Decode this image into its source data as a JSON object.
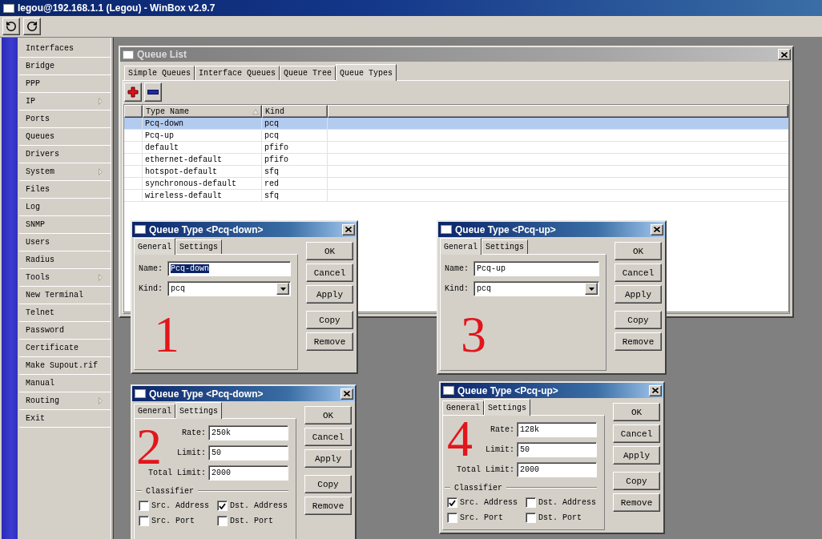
{
  "window": {
    "title": "legou@192.168.1.1 (Legou) - WinBox v2.9.7"
  },
  "sidebar": {
    "items": [
      {
        "label": "Interfaces",
        "has_submenu": false
      },
      {
        "label": "Bridge",
        "has_submenu": false
      },
      {
        "label": "PPP",
        "has_submenu": false
      },
      {
        "label": "IP",
        "has_submenu": true
      },
      {
        "label": "Ports",
        "has_submenu": false
      },
      {
        "label": "Queues",
        "has_submenu": false
      },
      {
        "label": "Drivers",
        "has_submenu": false
      },
      {
        "label": "System",
        "has_submenu": true
      },
      {
        "label": "Files",
        "has_submenu": false
      },
      {
        "label": "Log",
        "has_submenu": false
      },
      {
        "label": "SNMP",
        "has_submenu": false
      },
      {
        "label": "Users",
        "has_submenu": false
      },
      {
        "label": "Radius",
        "has_submenu": false
      },
      {
        "label": "Tools",
        "has_submenu": true
      },
      {
        "label": "New Terminal",
        "has_submenu": false
      },
      {
        "label": "Telnet",
        "has_submenu": false
      },
      {
        "label": "Password",
        "has_submenu": false
      },
      {
        "label": "Certificate",
        "has_submenu": false
      },
      {
        "label": "Make Supout.rif",
        "has_submenu": false
      },
      {
        "label": "Manual",
        "has_submenu": false
      },
      {
        "label": "Routing",
        "has_submenu": true
      },
      {
        "label": "Exit",
        "has_submenu": false
      }
    ]
  },
  "queue_list": {
    "title": "Queue List",
    "active": false,
    "tabs": [
      {
        "label": "Simple Queues",
        "selected": false
      },
      {
        "label": "Interface Queues",
        "selected": false
      },
      {
        "label": "Queue Tree",
        "selected": false
      },
      {
        "label": "Queue Types",
        "selected": true
      }
    ],
    "table": {
      "columns": [
        {
          "label": "Type Name",
          "sorted": true
        },
        {
          "label": "Kind",
          "sorted": false
        }
      ],
      "rows": [
        {
          "cells": [
            "Pcq-down",
            "pcq"
          ],
          "selected": true
        },
        {
          "cells": [
            "Pcq-up",
            "pcq"
          ],
          "selected": false
        },
        {
          "cells": [
            "default",
            "pfifo"
          ],
          "selected": false
        },
        {
          "cells": [
            "ethernet-default",
            "pfifo"
          ],
          "selected": false
        },
        {
          "cells": [
            "hotspot-default",
            "sfq"
          ],
          "selected": false
        },
        {
          "cells": [
            "synchronous-default",
            "red"
          ],
          "selected": false
        },
        {
          "cells": [
            "wireless-default",
            "sfq"
          ],
          "selected": false
        }
      ]
    }
  },
  "dialogs": [
    {
      "kind": "general",
      "title": "Queue Type <Pcq-down>",
      "active": true,
      "annotation": "1",
      "tabs": [
        {
          "label": "General",
          "selected": true
        },
        {
          "label": "Settings",
          "selected": false
        }
      ],
      "fields": [
        {
          "kind": "text",
          "label": "Name:",
          "value": "Pcq-down",
          "text_selected": true
        },
        {
          "kind": "dropdown",
          "label": "Kind:",
          "value": "pcq",
          "text_selected": false
        }
      ],
      "buttons": [
        "OK",
        "Cancel",
        "Apply",
        "Copy",
        "Remove"
      ]
    },
    {
      "kind": "general",
      "title": "Queue Type <Pcq-up>",
      "active": true,
      "annotation": "3",
      "tabs": [
        {
          "label": "General",
          "selected": true
        },
        {
          "label": "Settings",
          "selected": false
        }
      ],
      "fields": [
        {
          "kind": "text",
          "label": "Name:",
          "value": "Pcq-up",
          "text_selected": false
        },
        {
          "kind": "dropdown",
          "label": "Kind:",
          "value": "pcq",
          "text_selected": false
        }
      ],
      "buttons": [
        "OK",
        "Cancel",
        "Apply",
        "Copy",
        "Remove"
      ]
    },
    {
      "kind": "settings",
      "title": "Queue Type <Pcq-down>",
      "active": true,
      "annotation": "2",
      "tabs": [
        {
          "label": "General",
          "selected": false
        },
        {
          "label": "Settings",
          "selected": true
        }
      ],
      "fields": [
        {
          "kind": "text",
          "label": "Rate:",
          "value": "250k",
          "text_selected": false
        },
        {
          "kind": "text",
          "label": "Limit:",
          "value": "50",
          "text_selected": false
        },
        {
          "kind": "text",
          "label": "Total Limit:",
          "value": "2000",
          "text_selected": false
        }
      ],
      "classifier": {
        "title": "Classifier",
        "options": [
          {
            "label": "Src. Address",
            "checked": false
          },
          {
            "label": "Dst. Address",
            "checked": true
          },
          {
            "label": "Src. Port",
            "checked": false
          },
          {
            "label": "Dst. Port",
            "checked": false
          }
        ]
      },
      "buttons": [
        "OK",
        "Cancel",
        "Apply",
        "Copy",
        "Remove"
      ]
    },
    {
      "kind": "settings",
      "title": "Queue Type <Pcq-up>",
      "active": true,
      "annotation": "4",
      "tabs": [
        {
          "label": "General",
          "selected": false
        },
        {
          "label": "Settings",
          "selected": true
        }
      ],
      "fields": [
        {
          "kind": "text",
          "label": "Rate:",
          "value": "128k",
          "text_selected": false
        },
        {
          "kind": "text",
          "label": "Limit:",
          "value": "50",
          "text_selected": false
        },
        {
          "kind": "text",
          "label": "Total Limit:",
          "value": "2000",
          "text_selected": false
        }
      ],
      "classifier": {
        "title": "Classifier",
        "options": [
          {
            "label": "Src. Address",
            "checked": true
          },
          {
            "label": "Dst. Address",
            "checked": false
          },
          {
            "label": "Src. Port",
            "checked": false
          },
          {
            "label": "Dst. Port",
            "checked": false
          }
        ]
      },
      "buttons": [
        "OK",
        "Cancel",
        "Apply",
        "Copy",
        "Remove"
      ]
    }
  ]
}
